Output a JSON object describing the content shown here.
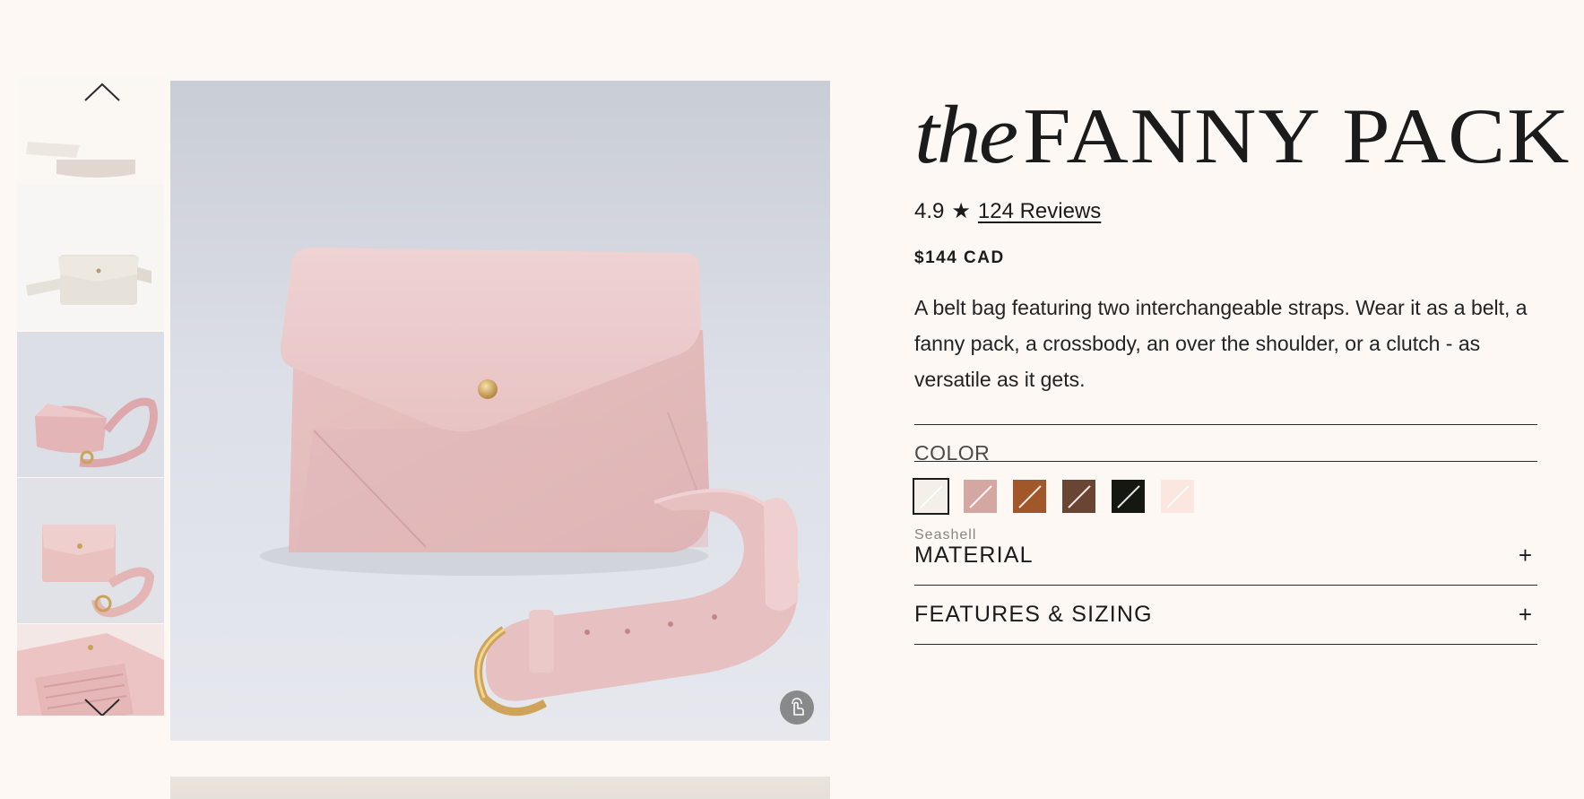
{
  "product": {
    "title_prefix": "the",
    "title_name": "FANNY PACK",
    "rating_value": "4.9",
    "rating_star": "★",
    "reviews_label": "124 Reviews",
    "price": "$144 CAD",
    "description": "A belt bag featuring two interchangeable straps. Wear it as a belt, a fanny pack, a crossbody, an over the shoulder, or a clutch - as versatile as it gets."
  },
  "color": {
    "label": "COLOR",
    "selected_name": "Seashell",
    "swatches": [
      {
        "name": "Seashell",
        "hex": "#f4efe9",
        "selected": true
      },
      {
        "name": "Blush",
        "hex": "#d4a7a2",
        "selected": false
      },
      {
        "name": "Cognac",
        "hex": "#a2572a",
        "selected": false
      },
      {
        "name": "Chocolate",
        "hex": "#6b4534",
        "selected": false
      },
      {
        "name": "Black",
        "hex": "#141811",
        "selected": false
      },
      {
        "name": "Pale Pink",
        "hex": "#fbe6e0",
        "selected": false
      }
    ]
  },
  "accordion": {
    "items": [
      {
        "label": "MATERIAL",
        "icon": "+"
      },
      {
        "label": "FEATURES & SIZING",
        "icon": "+"
      }
    ]
  },
  "gallery": {
    "thumbnail_icons": [
      "chevron-up-icon",
      "chevron-down-icon"
    ],
    "zoom_icon": "hand-pointer-icon"
  }
}
